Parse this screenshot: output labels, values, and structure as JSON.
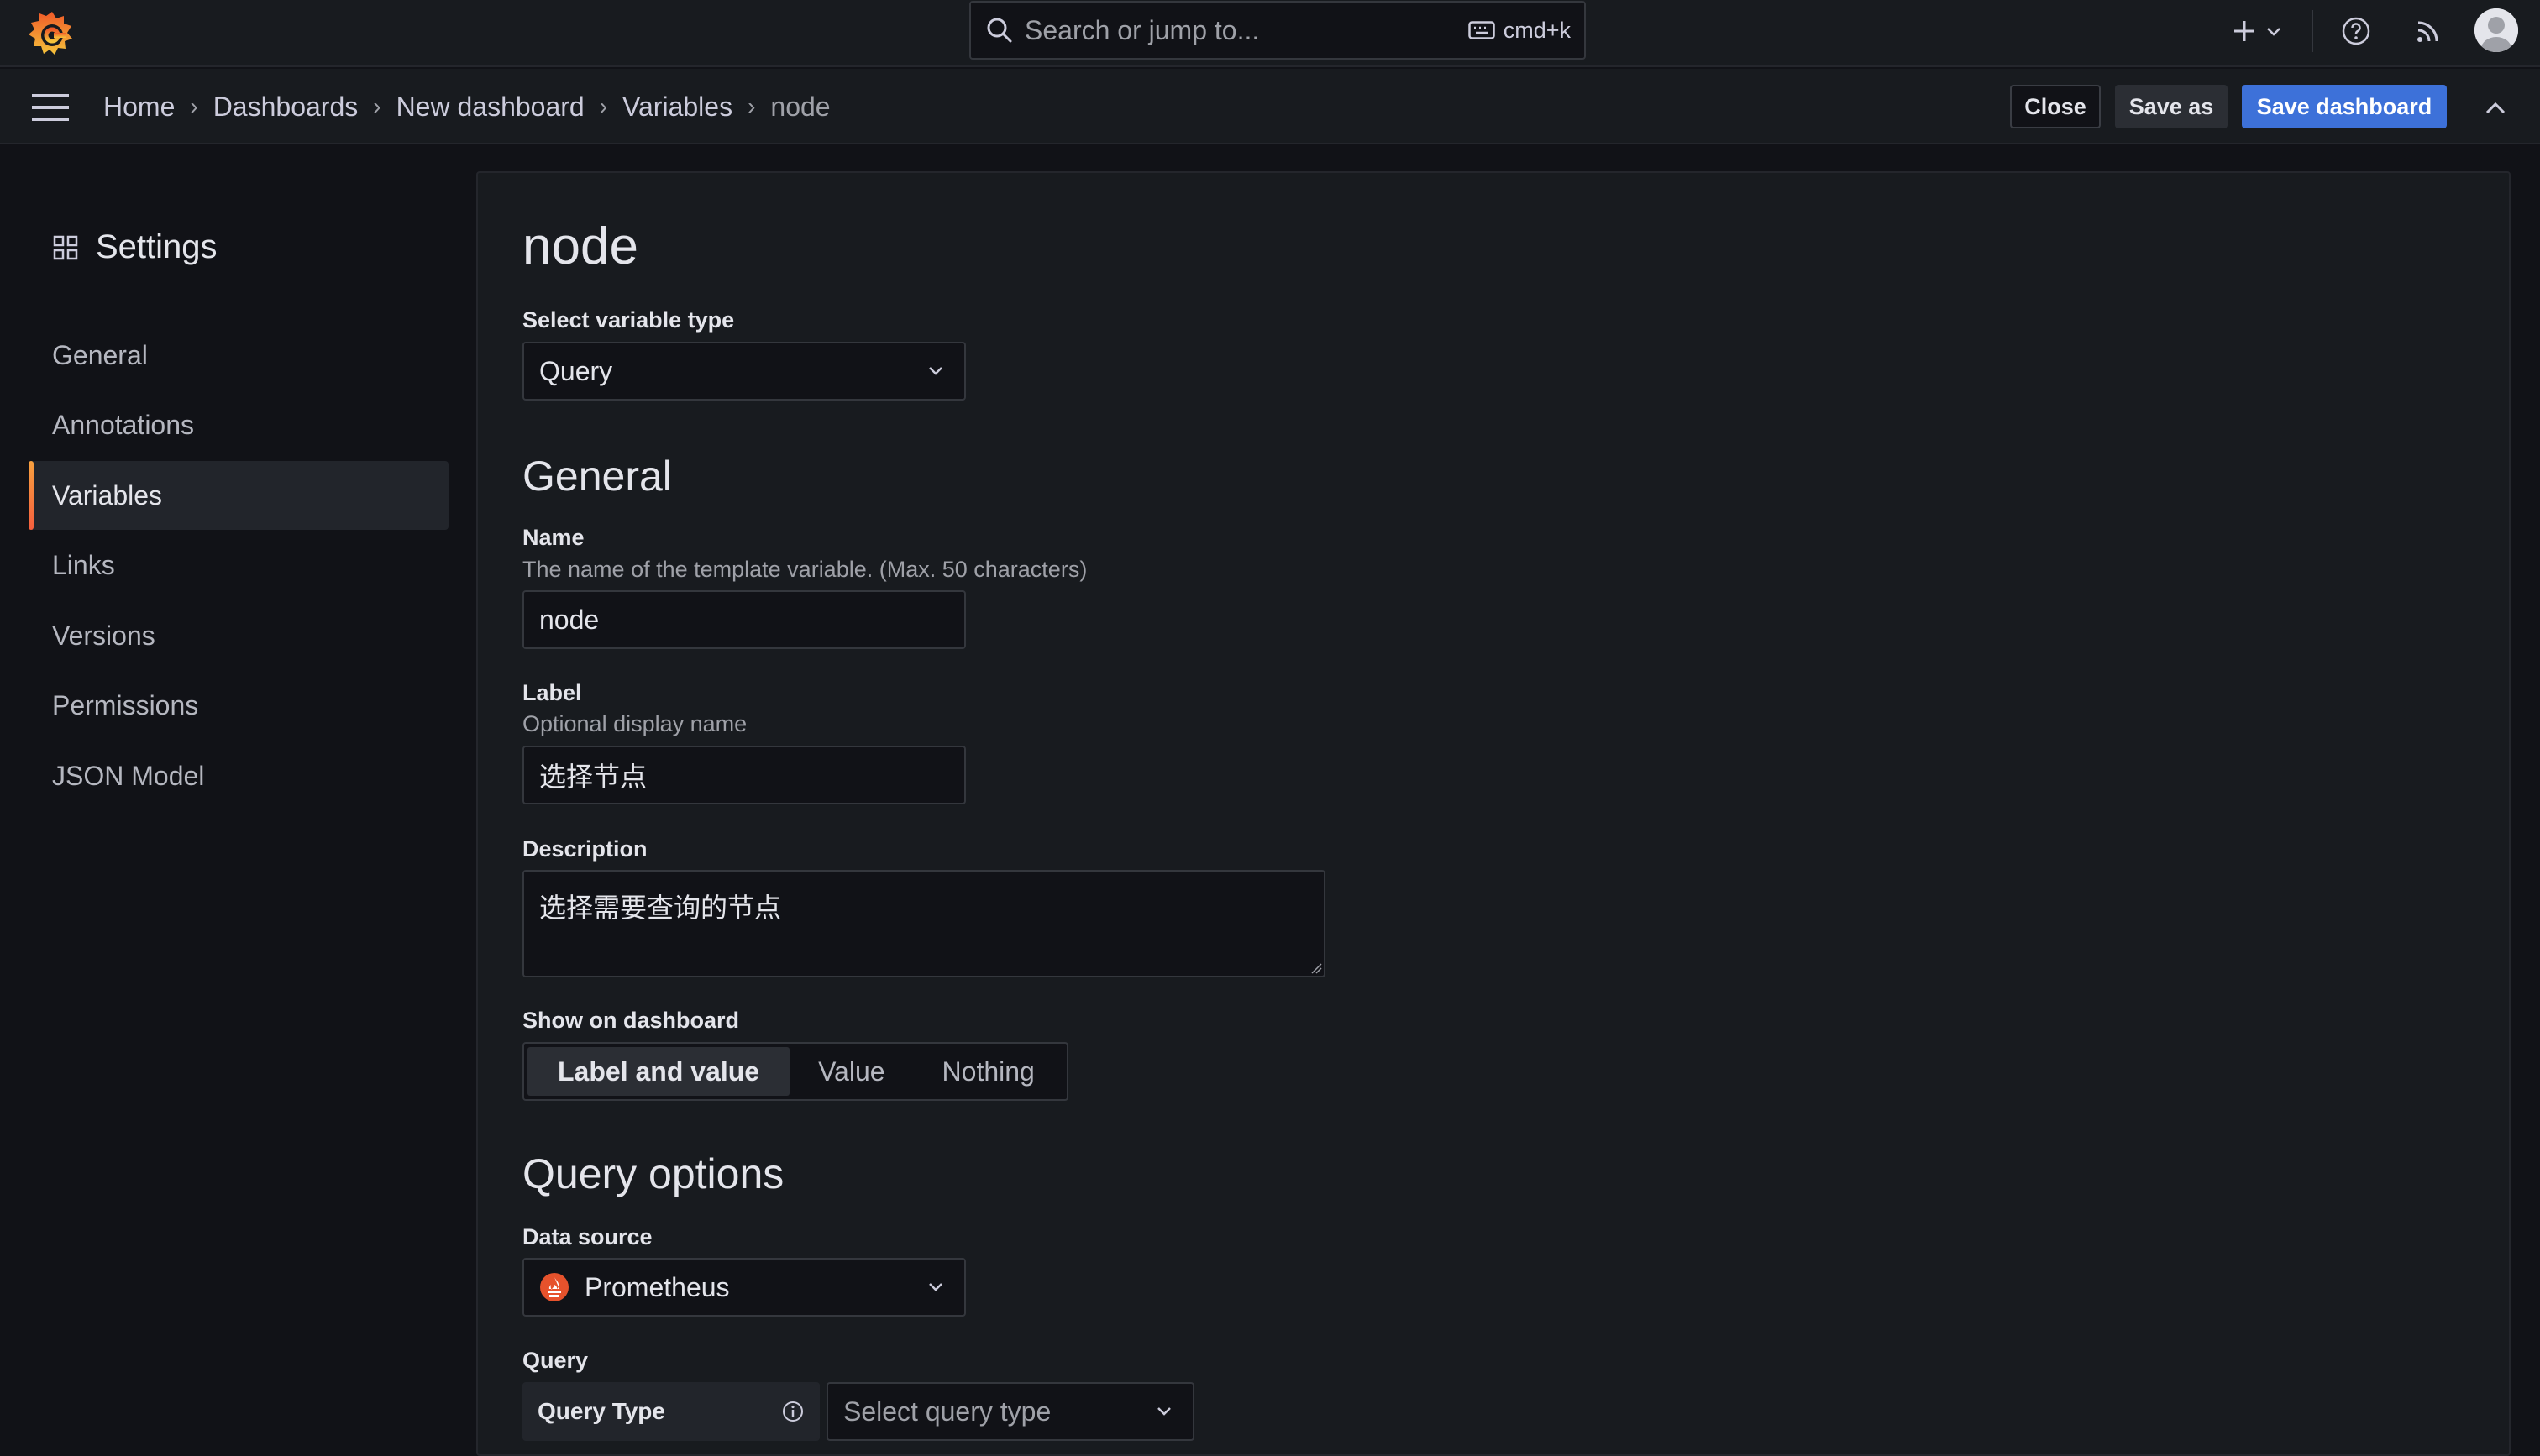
{
  "topbar": {
    "search_placeholder": "Search or jump to...",
    "shortcut": "cmd+k",
    "icons": [
      "grafana-logo-icon",
      "search-icon",
      "keyboard-icon",
      "plus-icon",
      "chevron-down-icon",
      "help-icon",
      "rss-icon",
      "user-avatar-icon"
    ]
  },
  "breadcrumb": {
    "items": [
      "Home",
      "Dashboards",
      "New dashboard",
      "Variables"
    ],
    "current": "node"
  },
  "actions": {
    "close": "Close",
    "save_as": "Save as",
    "save_dashboard": "Save dashboard"
  },
  "sidebar": {
    "title": "Settings",
    "items": [
      {
        "label": "General",
        "active": false
      },
      {
        "label": "Annotations",
        "active": false
      },
      {
        "label": "Variables",
        "active": true
      },
      {
        "label": "Links",
        "active": false
      },
      {
        "label": "Versions",
        "active": false
      },
      {
        "label": "Permissions",
        "active": false
      },
      {
        "label": "JSON Model",
        "active": false
      }
    ]
  },
  "form": {
    "title": "node",
    "variable_type": {
      "label": "Select variable type",
      "value": "Query"
    },
    "general_heading": "General",
    "name": {
      "label": "Name",
      "description": "The name of the template variable. (Max. 50 characters)",
      "value": "node"
    },
    "label_field": {
      "label": "Label",
      "description": "Optional display name",
      "value": "选择节点"
    },
    "description": {
      "label": "Description",
      "value": "选择需要查询的节点"
    },
    "show_on_dashboard": {
      "label": "Show on dashboard",
      "options": [
        "Label and value",
        "Value",
        "Nothing"
      ],
      "selected": "Label and value"
    },
    "query_options_heading": "Query options",
    "data_source": {
      "label": "Data source",
      "value": "Prometheus"
    },
    "query": {
      "label": "Query",
      "query_type_label": "Query Type",
      "query_type_placeholder": "Select query type"
    }
  },
  "colors": {
    "accent_blue": "#3d71d9",
    "active_bar": "#f55f3e",
    "background": "#111217",
    "panel": "#181b1f",
    "prometheus": "#e6522c"
  }
}
